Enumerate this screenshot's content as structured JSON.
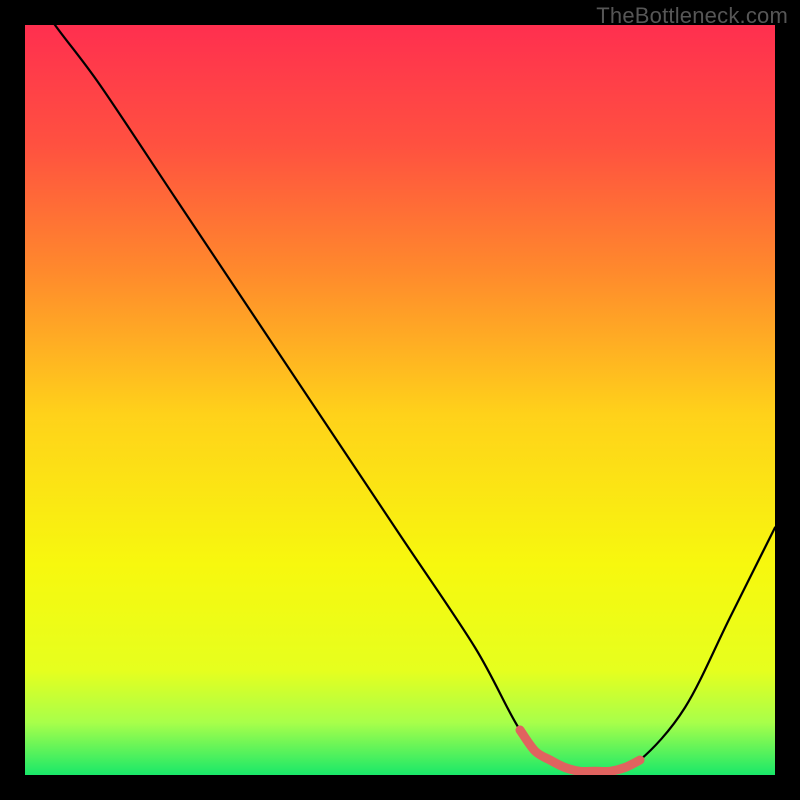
{
  "watermark": "TheBottleneck.com",
  "colors": {
    "gradient": [
      "#ff2f4f",
      "#ff5140",
      "#ff8a2c",
      "#ffd21a",
      "#f7f80e",
      "#e6ff1e",
      "#a8ff4a",
      "#19e869"
    ],
    "curve": "#000000",
    "sweet_spot": "#e0635f"
  },
  "chart_data": {
    "type": "line",
    "title": "",
    "xlabel": "",
    "ylabel": "",
    "x_range": [
      0,
      100
    ],
    "y_range": [
      0,
      100
    ],
    "series": [
      {
        "name": "bottleneck-curve",
        "x": [
          0,
          4,
          10,
          20,
          30,
          40,
          50,
          60,
          66,
          70,
          74,
          78,
          82,
          88,
          94,
          100
        ],
        "y": [
          106,
          100,
          92,
          77,
          62,
          47,
          32,
          17,
          6,
          2,
          0.5,
          0.5,
          2,
          9,
          21,
          33
        ]
      },
      {
        "name": "sweet-spot",
        "x": [
          66,
          68,
          70,
          72,
          74,
          76,
          78,
          80,
          82
        ],
        "y": [
          6,
          3.2,
          2,
          1,
          0.5,
          0.5,
          0.5,
          1,
          2
        ]
      }
    ]
  }
}
